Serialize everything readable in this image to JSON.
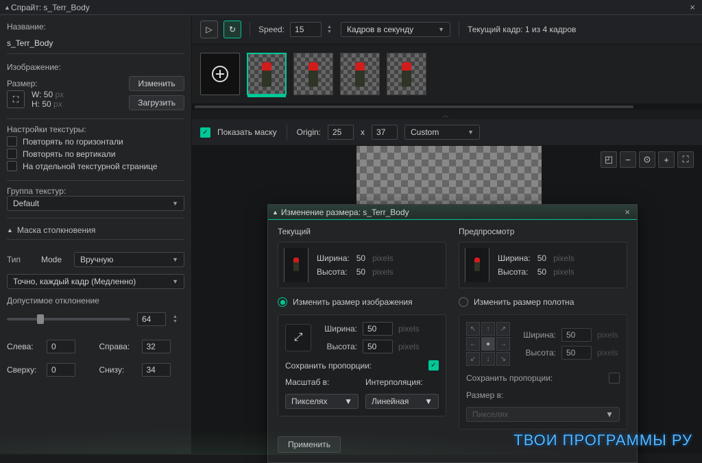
{
  "window": {
    "title_prefix": "Спрайт:",
    "sprite_name": "s_Terr_Body"
  },
  "left": {
    "name_label": "Название:",
    "name_value": "s_Terr_Body",
    "image_label": "Изображение:",
    "size_label": "Размер:",
    "w_label": "W:",
    "w_value": "50",
    "h_label": "H:",
    "h_value": "50",
    "px": "px",
    "edit_btn": "Изменить",
    "load_btn": "Загрузить",
    "tex_settings": "Настройки текстуры:",
    "chk_htile": "Повторять по горизонтали",
    "chk_vtile": "Повторять по вертикали",
    "chk_sep_page": "На отдельной текстурной странице",
    "tex_group_label": "Группа текстур:",
    "tex_group_value": "Default",
    "collision_title": "Маска столкновения",
    "type_label": "Тип",
    "mode_label": "Mode",
    "mode_value": "Вручную",
    "shape_value": "Точно, каждый кадр (Медленно)",
    "tolerance_label": "Допустимое отклонение",
    "tolerance_value": "64",
    "left_label": "Слева:",
    "left_value": "0",
    "right_label": "Справа:",
    "right_value": "32",
    "top_label": "Сверху:",
    "top_value": "0",
    "bottom_label": "Снизу:",
    "bottom_value": "34"
  },
  "toolbar": {
    "speed_label": "Speed:",
    "speed_value": "15",
    "fps_label": "Кадров в секунду",
    "current_frame_prefix": "Текущий кадр:",
    "current_frame_value": "1 из 4 кадров"
  },
  "maskbar": {
    "show_mask": "Показать маску",
    "origin_label": "Origin:",
    "origin_x": "25",
    "origin_sep": "x",
    "origin_y": "37",
    "origin_preset": "Custom"
  },
  "dialog": {
    "title_prefix": "Изменение размера:",
    "current_label": "Текущий",
    "preview_label": "Предпросмотр",
    "width_label": "Ширина:",
    "height_label": "Высота:",
    "pixels": "pixels",
    "cur_w": "50",
    "cur_h": "50",
    "prev_w": "50",
    "prev_h": "50",
    "resize_image_label": "Изменить размер изображения",
    "resize_canvas_label": "Изменить размер полотна",
    "scale_w": "50",
    "scale_h": "50",
    "canvas_w": "50",
    "canvas_h": "50",
    "keep_ratio": "Сохранить пропорции:",
    "scale_in": "Масштаб в:",
    "interp_label": "Интерполяция:",
    "size_in": "Размер в:",
    "unit_pixels": "Пикселях",
    "interp_value": "Линейная",
    "apply": "Применить"
  },
  "watermark": "ТВОИ ПРОГРАММЫ РУ"
}
